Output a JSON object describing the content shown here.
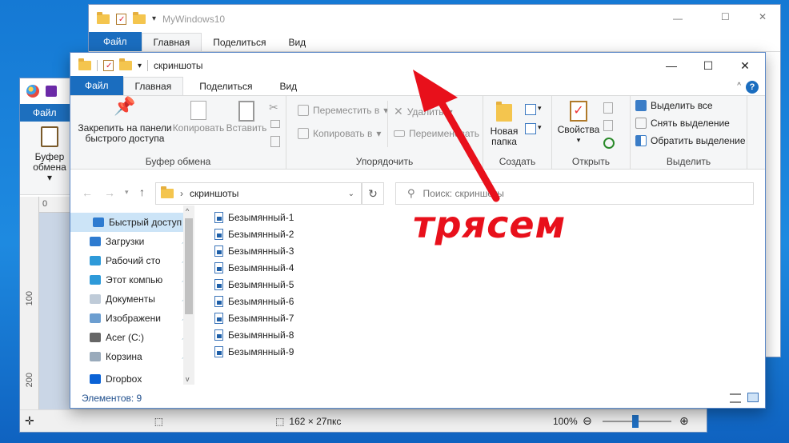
{
  "paint": {
    "menu_file": "Файл",
    "clipboard_label": "Буфер обмена",
    "ruler_h_0": "0",
    "ruler_v_100": "100",
    "ruler_v_200": "200",
    "selection_size": "162 × 27пкс",
    "zoom": "100%",
    "zoom_minus": "⊖",
    "zoom_plus": "⊕"
  },
  "back_window": {
    "title": "MyWindows10",
    "tabs": [
      "Файл",
      "Главная",
      "Поделиться",
      "Вид"
    ]
  },
  "window": {
    "title": "скриншоты",
    "minimize": "—",
    "maximize": "☐",
    "close": "✕",
    "help": "?",
    "tabs": [
      "Файл",
      "Главная",
      "Поделиться",
      "Вид"
    ],
    "ribbon": {
      "clipboard": {
        "label": "Буфер обмена",
        "pin": "Закрепить на панели быстрого доступа",
        "copy": "Копировать",
        "paste": "Вставить"
      },
      "organize": {
        "label": "Упорядочить",
        "move": "Переместить в",
        "copy_to": "Копировать в",
        "delete": "Удалить",
        "rename": "Переименовать"
      },
      "create": {
        "label": "Создать",
        "new_folder": "Новая папка"
      },
      "open": {
        "label": "Открыть",
        "properties": "Свойства"
      },
      "select": {
        "label": "Выделить",
        "select_all": "Выделить все",
        "select_none": "Снять выделение",
        "invert": "Обратить выделение"
      }
    },
    "address": {
      "path": "скриншоты",
      "search_placeholder": "Поиск: скриншоты"
    },
    "nav": [
      {
        "label": "Быстрый доступ",
        "selected": true,
        "pinned": false,
        "icon": "star-icon"
      },
      {
        "label": "Загрузки",
        "selected": false,
        "pinned": true,
        "icon": "download-icon"
      },
      {
        "label": "Рабочий сто",
        "selected": false,
        "pinned": true,
        "icon": "desktop-icon"
      },
      {
        "label": "Этот компью",
        "selected": false,
        "pinned": true,
        "icon": "computer-icon"
      },
      {
        "label": "Документы",
        "selected": false,
        "pinned": true,
        "icon": "documents-icon"
      },
      {
        "label": "Изображени",
        "selected": false,
        "pinned": true,
        "icon": "pictures-icon"
      },
      {
        "label": "Acer (C:)",
        "selected": false,
        "pinned": true,
        "icon": "drive-icon"
      },
      {
        "label": "Корзина",
        "selected": false,
        "pinned": true,
        "icon": "recycle-bin-icon"
      },
      {
        "label": "Dropbox",
        "selected": false,
        "pinned": false,
        "icon": "dropbox-icon"
      }
    ],
    "files": [
      "Безымянный-1",
      "Безымянный-2",
      "Безымянный-3",
      "Безымянный-4",
      "Безымянный-5",
      "Безымянный-6",
      "Безымянный-7",
      "Безымянный-8",
      "Безымянный-9"
    ],
    "status": "Элементов: 9"
  },
  "annotation": {
    "text": "трясем",
    "color": "#e8101b"
  }
}
